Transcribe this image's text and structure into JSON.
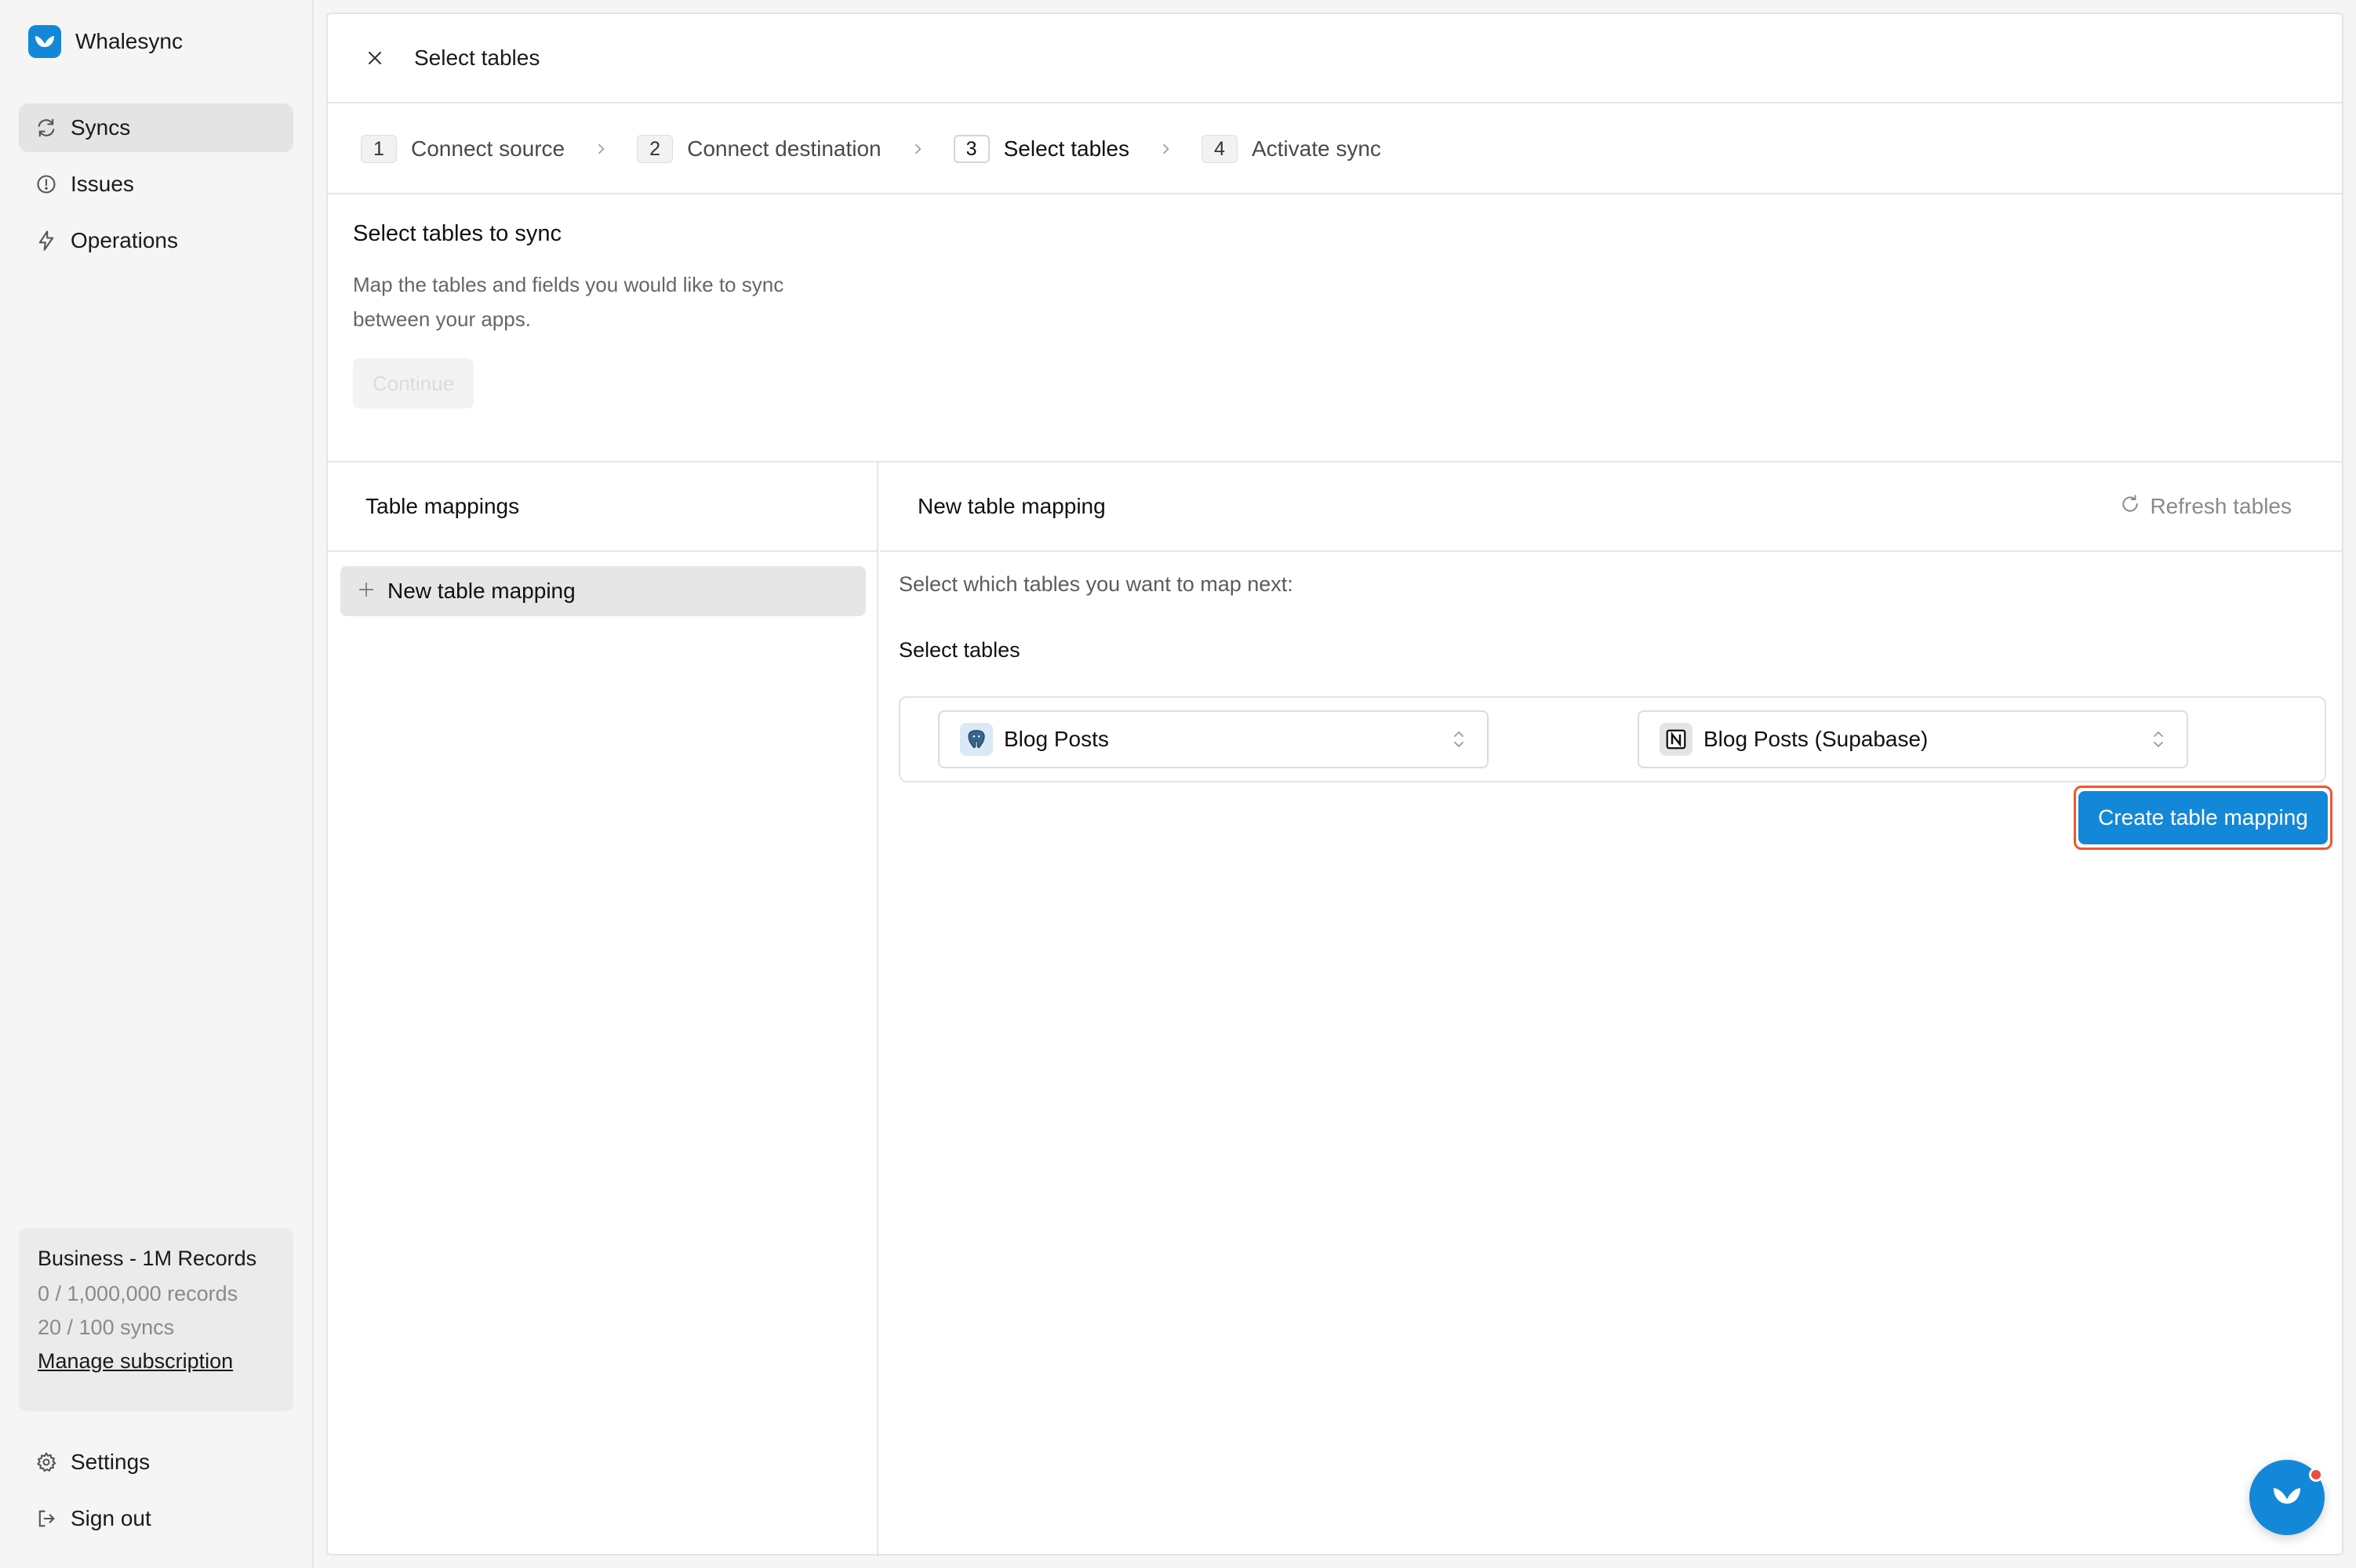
{
  "app": {
    "name": "Whalesync",
    "brand_color": "#1488d8"
  },
  "sidebar": {
    "items": [
      {
        "label": "Syncs",
        "icon": "sync-icon",
        "active": true
      },
      {
        "label": "Issues",
        "icon": "alert-circle-icon",
        "active": false
      },
      {
        "label": "Operations",
        "icon": "bolt-icon",
        "active": false
      }
    ],
    "plan": {
      "title": "Business - 1M Records",
      "records": "0 / 1,000,000 records",
      "syncs": "20 / 100 syncs",
      "manage_label": "Manage subscription"
    },
    "bottom": [
      {
        "label": "Settings",
        "icon": "gear-icon"
      },
      {
        "label": "Sign out",
        "icon": "sign-out-icon"
      }
    ]
  },
  "header": {
    "title": "Select tables"
  },
  "stepper": {
    "steps": [
      {
        "num": "1",
        "label": "Connect source"
      },
      {
        "num": "2",
        "label": "Connect destination"
      },
      {
        "num": "3",
        "label": "Select tables",
        "current": true
      },
      {
        "num": "4",
        "label": "Activate sync"
      }
    ]
  },
  "intro": {
    "title": "Select tables to sync",
    "description": "Map the tables and fields you would like to sync between your apps.",
    "continue_label": "Continue"
  },
  "mappings": {
    "heading": "Table mappings",
    "new_item_label": "New table mapping"
  },
  "new_mapping": {
    "heading": "New table mapping",
    "refresh_label": "Refresh tables",
    "prompt": "Select which tables you want to map next:",
    "select_label": "Select tables",
    "source_table": "Blog Posts",
    "source_icon": "postgres-icon",
    "destination_table": "Blog Posts (Supabase)",
    "destination_icon": "notion-icon",
    "create_label": "Create table mapping",
    "highlight_color": "#f0562f"
  }
}
